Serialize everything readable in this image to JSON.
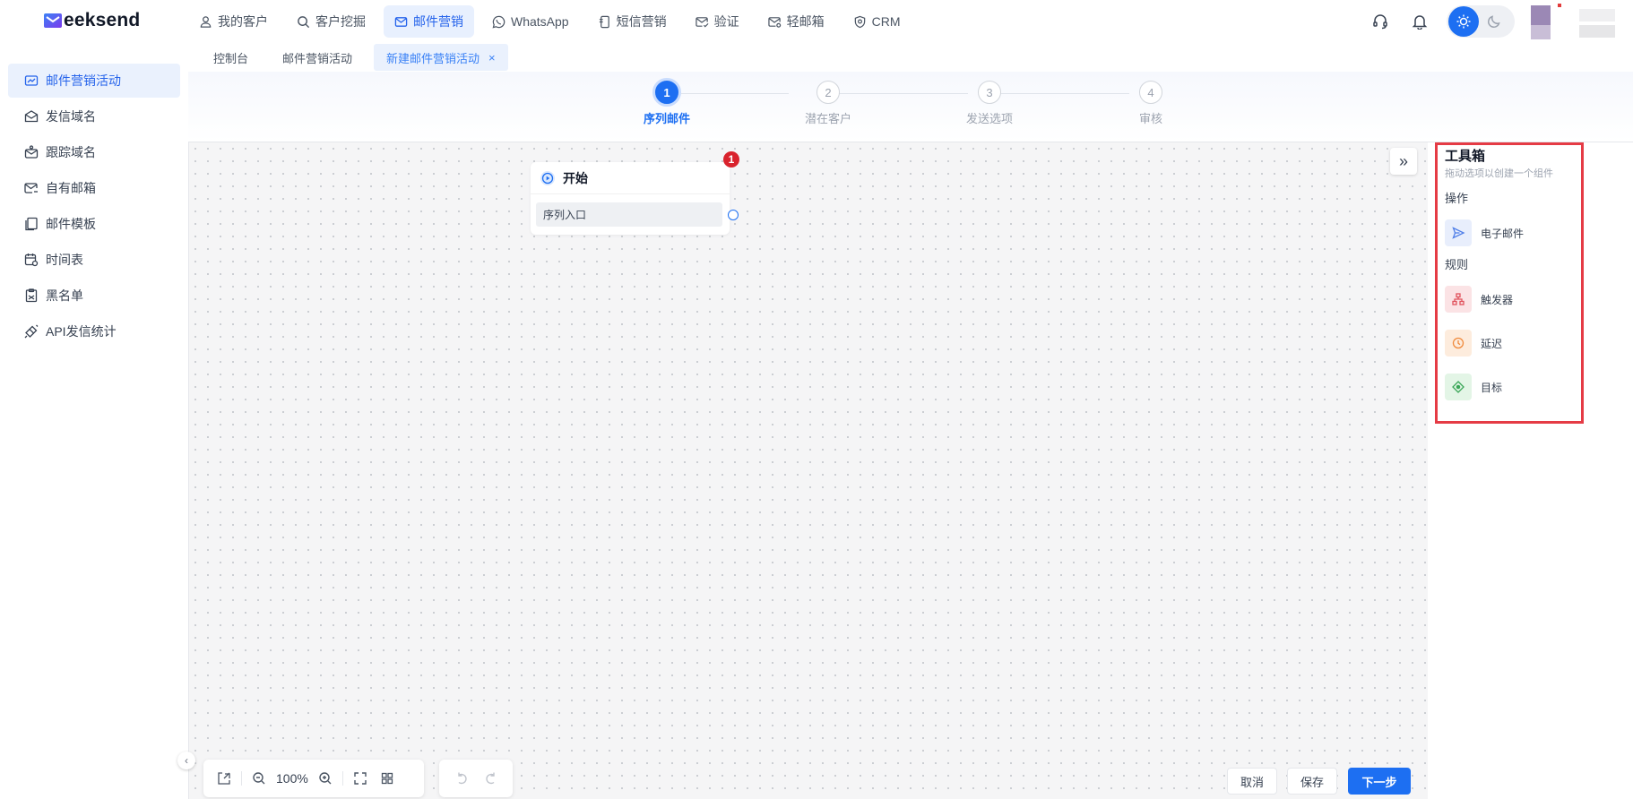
{
  "brand": {
    "logo_text": "eeksend"
  },
  "nav": [
    {
      "label": "我的客户",
      "icon": "user-icon"
    },
    {
      "label": "客户挖掘",
      "icon": "search-icon"
    },
    {
      "label": "邮件营销",
      "icon": "mail-icon",
      "active": true
    },
    {
      "label": "WhatsApp",
      "icon": "whatsapp-icon"
    },
    {
      "label": "短信营销",
      "icon": "sms-icon"
    },
    {
      "label": "验证",
      "icon": "mail-check-icon"
    },
    {
      "label": "轻邮箱",
      "icon": "mail-light-icon"
    },
    {
      "label": "CRM",
      "icon": "crm-shield-icon"
    }
  ],
  "sidebar": {
    "items": [
      {
        "label": "邮件营销活动",
        "icon": "campaign-icon",
        "active": true
      },
      {
        "label": "发信域名",
        "icon": "domain-icon"
      },
      {
        "label": "跟踪域名",
        "icon": "tracking-icon"
      },
      {
        "label": "自有邮箱",
        "icon": "mailbox-icon"
      },
      {
        "label": "邮件模板",
        "icon": "template-icon"
      },
      {
        "label": "时间表",
        "icon": "schedule-icon"
      },
      {
        "label": "黑名单",
        "icon": "blacklist-icon"
      },
      {
        "label": "API发信统计",
        "icon": "api-icon"
      }
    ]
  },
  "tabs": [
    {
      "label": "控制台"
    },
    {
      "label": "邮件营销活动"
    },
    {
      "label": "新建邮件营销活动",
      "active": true,
      "closable": "×"
    }
  ],
  "steps": [
    {
      "number": "1",
      "label": "序列邮件",
      "active": true
    },
    {
      "number": "2",
      "label": "潜在客户"
    },
    {
      "number": "3",
      "label": "发送选项"
    },
    {
      "number": "4",
      "label": "审核"
    }
  ],
  "canvas": {
    "start_node": {
      "title": "开始",
      "badge": "1",
      "entry_label": "序列入口"
    },
    "collapse_symbol": "»",
    "zoom": "100%"
  },
  "actions": {
    "cancel": "取消",
    "save": "保存",
    "next": "下一步"
  },
  "toolbox": {
    "title": "工具箱",
    "subtitle": "拖动选项以创建一个组件",
    "groups": [
      {
        "label": "操作",
        "items": [
          {
            "label": "电子邮件",
            "icon": "send-icon",
            "color": "#e8eefc"
          }
        ]
      },
      {
        "label": "规则",
        "items": [
          {
            "label": "触发器",
            "icon": "trigger-icon",
            "color": "#fbe3e5"
          },
          {
            "label": "延迟",
            "icon": "clock-icon",
            "color": "#fdecdd"
          },
          {
            "label": "目标",
            "icon": "target-icon",
            "color": "#e3f5e6"
          }
        ]
      }
    ]
  },
  "colors": {
    "primary": "#1d6ff2",
    "highlight_frame": "#e53b45",
    "badge": "#d9232d"
  }
}
